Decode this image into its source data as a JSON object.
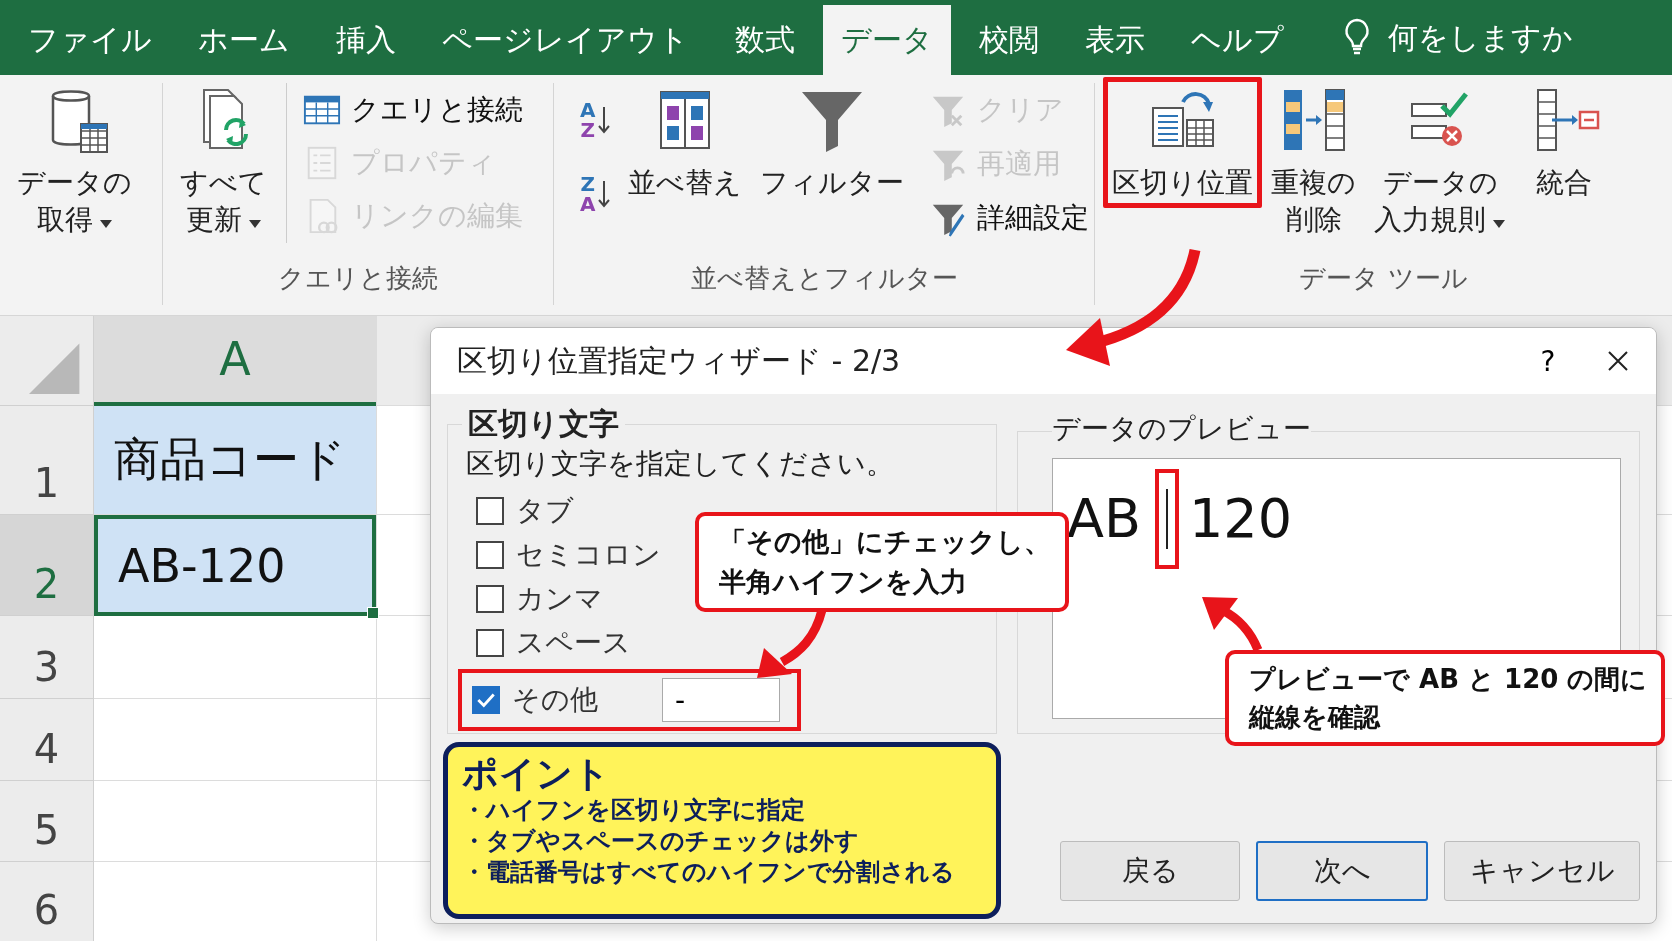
{
  "tabs": [
    {
      "label": "ファイル",
      "selected": false
    },
    {
      "label": "ホーム",
      "selected": false
    },
    {
      "label": "挿入",
      "selected": false
    },
    {
      "label": "ページレイアウト",
      "selected": false
    },
    {
      "label": "数式",
      "selected": false
    },
    {
      "label": "データ",
      "selected": true
    },
    {
      "label": "校閲",
      "selected": false
    },
    {
      "label": "表示",
      "selected": false
    },
    {
      "label": "ヘルプ",
      "selected": false
    }
  ],
  "tell_me": {
    "placeholder": "何をしますか"
  },
  "ribbon": {
    "groups": [
      {
        "items": [
          {
            "kind": "large",
            "lines": [
              "データの",
              "取得"
            ],
            "dropdown": true,
            "highlighted": false
          }
        ]
      },
      {
        "label": "クエリと接続",
        "items": [
          {
            "kind": "large",
            "lines": [
              "すべて",
              "更新"
            ],
            "dropdown": true,
            "highlighted": false
          },
          {
            "kind": "stack",
            "children": [
              {
                "label": "クエリと接続",
                "disabled": false
              },
              {
                "label": "プロパティ",
                "disabled": true
              },
              {
                "label": "リンクの編集",
                "disabled": true
              }
            ]
          }
        ]
      },
      {
        "label": "並べ替えとフィルター",
        "items": [
          {
            "kind": "stack",
            "children": [
              {
                "letters": [
                  "A",
                  "Z"
                ]
              },
              {
                "letters": [
                  "Z",
                  "A"
                ]
              }
            ]
          },
          {
            "kind": "large",
            "lines": [
              "並べ替え"
            ],
            "dropdown": false,
            "highlighted": false
          },
          {
            "kind": "large",
            "lines": [
              "フィルター"
            ],
            "dropdown": false,
            "highlighted": false
          },
          {
            "kind": "stack",
            "children": [
              {
                "label": "クリア",
                "disabled": true
              },
              {
                "label": "再適用",
                "disabled": true
              },
              {
                "label": "詳細設定",
                "disabled": false
              }
            ]
          }
        ]
      },
      {
        "label": "データ ツール",
        "items": [
          {
            "kind": "large",
            "lines": [
              "区切り位置"
            ],
            "dropdown": false,
            "highlighted": true
          },
          {
            "kind": "large",
            "lines": [
              "重複の",
              "削除"
            ],
            "dropdown": false,
            "highlighted": false
          },
          {
            "kind": "large",
            "lines": [
              "データの",
              "入力規則"
            ],
            "dropdown": true,
            "highlighted": false
          },
          {
            "kind": "large",
            "lines": [
              "統合"
            ],
            "dropdown": false,
            "highlighted": false
          }
        ]
      }
    ]
  },
  "sheet": {
    "column": "A",
    "rows": [
      {
        "number": "1",
        "value": "商品コード",
        "selected": true,
        "active": false
      },
      {
        "number": "2",
        "value": "AB-120",
        "selected": true,
        "active": true
      },
      {
        "number": "3",
        "selected": false,
        "active": false
      },
      {
        "number": "4",
        "selected": false,
        "active": false
      },
      {
        "number": "5",
        "selected": false,
        "active": false
      },
      {
        "number": "6",
        "selected": false,
        "active": false
      }
    ]
  },
  "dialog": {
    "title": "区切り位置指定ウィザード - 2/3",
    "help": "?",
    "delimiters": {
      "legend": "区切り文字",
      "instruction": "区切り文字を指定してください。",
      "options": [
        {
          "label": "タブ",
          "checked": false,
          "highlighted": false
        },
        {
          "label": "セミコロン",
          "checked": false,
          "highlighted": false
        },
        {
          "label": "カンマ",
          "checked": false,
          "highlighted": false
        },
        {
          "label": "スペース",
          "checked": false,
          "highlighted": false
        },
        {
          "label": "その他",
          "checked": true,
          "highlighted": true,
          "value": "-"
        }
      ]
    },
    "preview": {
      "legend": "データのプレビュー",
      "columns": [
        "AB",
        "120"
      ],
      "break_highlighted": true
    },
    "buttons": [
      {
        "label": "戻る",
        "default": false
      },
      {
        "label": "次へ",
        "default": true
      },
      {
        "label": "キャンセル",
        "default": false
      }
    ]
  },
  "callouts": [
    {
      "lines": [
        "「その他」にチェックし、",
        "半角ハイフンを入力"
      ]
    },
    {
      "lines": [
        "プレビューで AB と 120 の間に",
        "縦線を確認"
      ]
    }
  ],
  "point": {
    "title": "ポイント",
    "bullets": [
      "・ハイフンを区切り文字に指定",
      "・タブやスペースのチェックは外す",
      "・電話番号はすべてのハイフンで分割される"
    ]
  }
}
